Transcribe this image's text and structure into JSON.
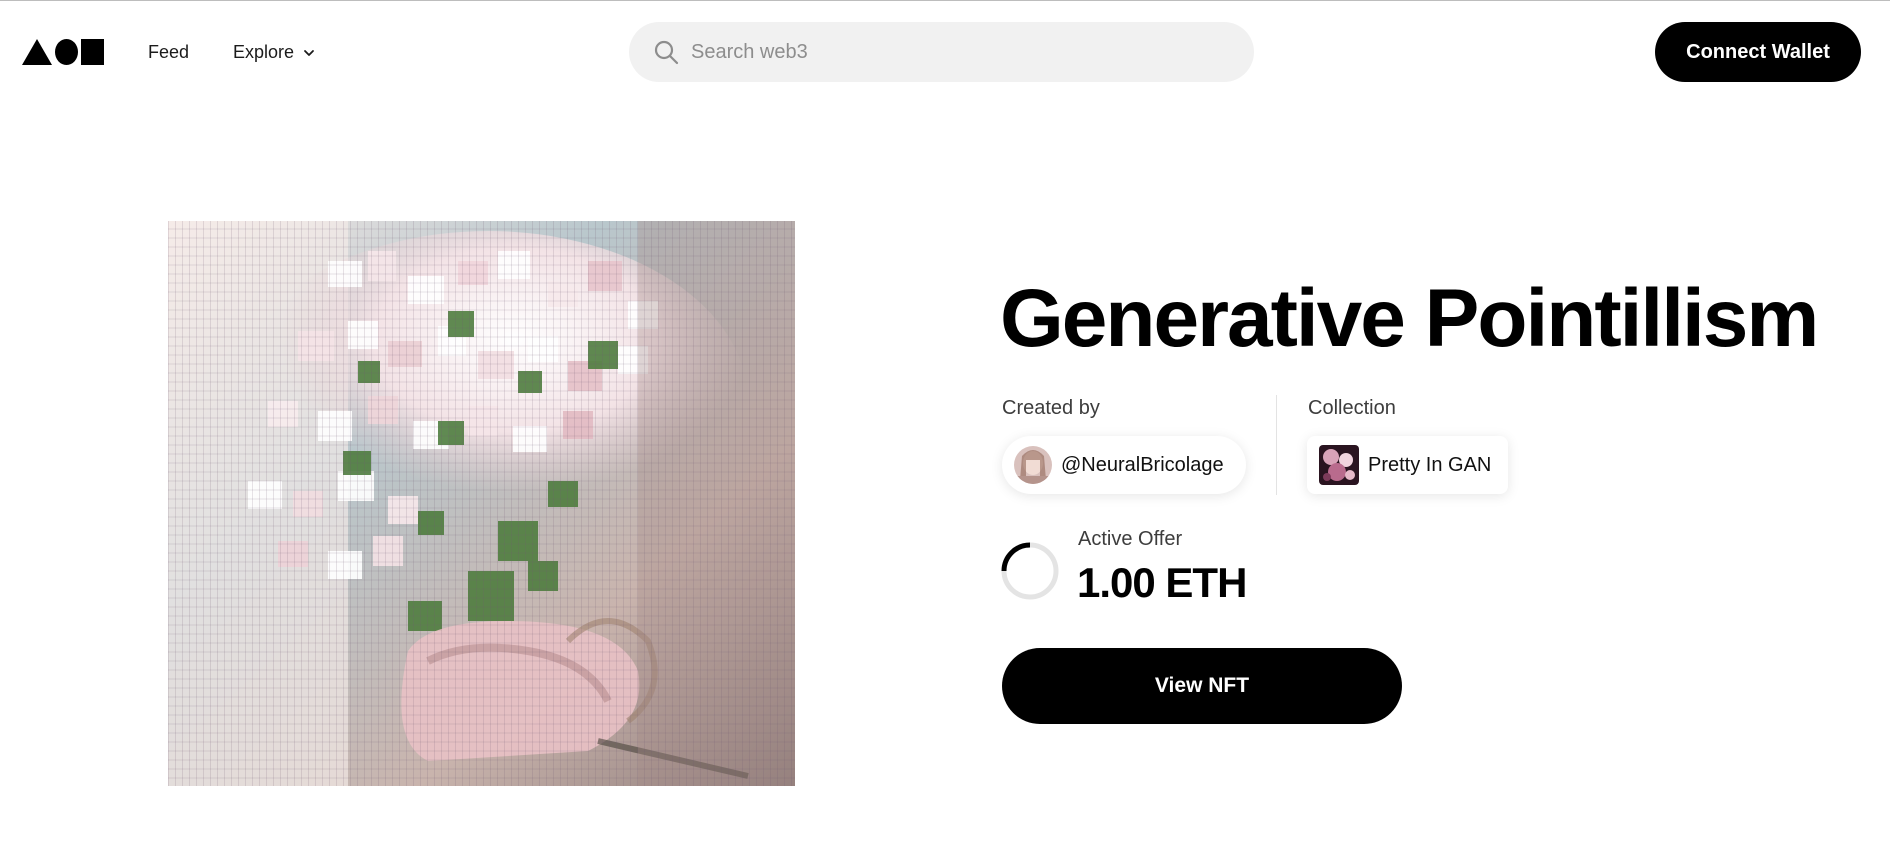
{
  "header": {
    "logo_icon": "foundation-shapes-logo",
    "nav": [
      {
        "label": "Feed"
      },
      {
        "label": "Explore",
        "icon": "chevron-down-icon"
      }
    ],
    "search": {
      "placeholder": "Search web3",
      "value": "",
      "icon": "search-icon"
    },
    "connect_wallet_label": "Connect Wallet"
  },
  "artwork": {
    "image": "generative-pointillism-flowers"
  },
  "nft": {
    "title": "Generative Pointillism",
    "created_by_label": "Created by",
    "creator_handle": "@NeuralBricolage",
    "collection_label": "Collection",
    "collection_name": "Pretty In GAN",
    "active_offer_label": "Active Offer",
    "active_offer_value": "1.00 ETH",
    "view_button_label": "View NFT"
  },
  "colors": {
    "primary": "#000000",
    "search_bg": "#f1f1f1",
    "text_muted": "#3d3d3d"
  }
}
